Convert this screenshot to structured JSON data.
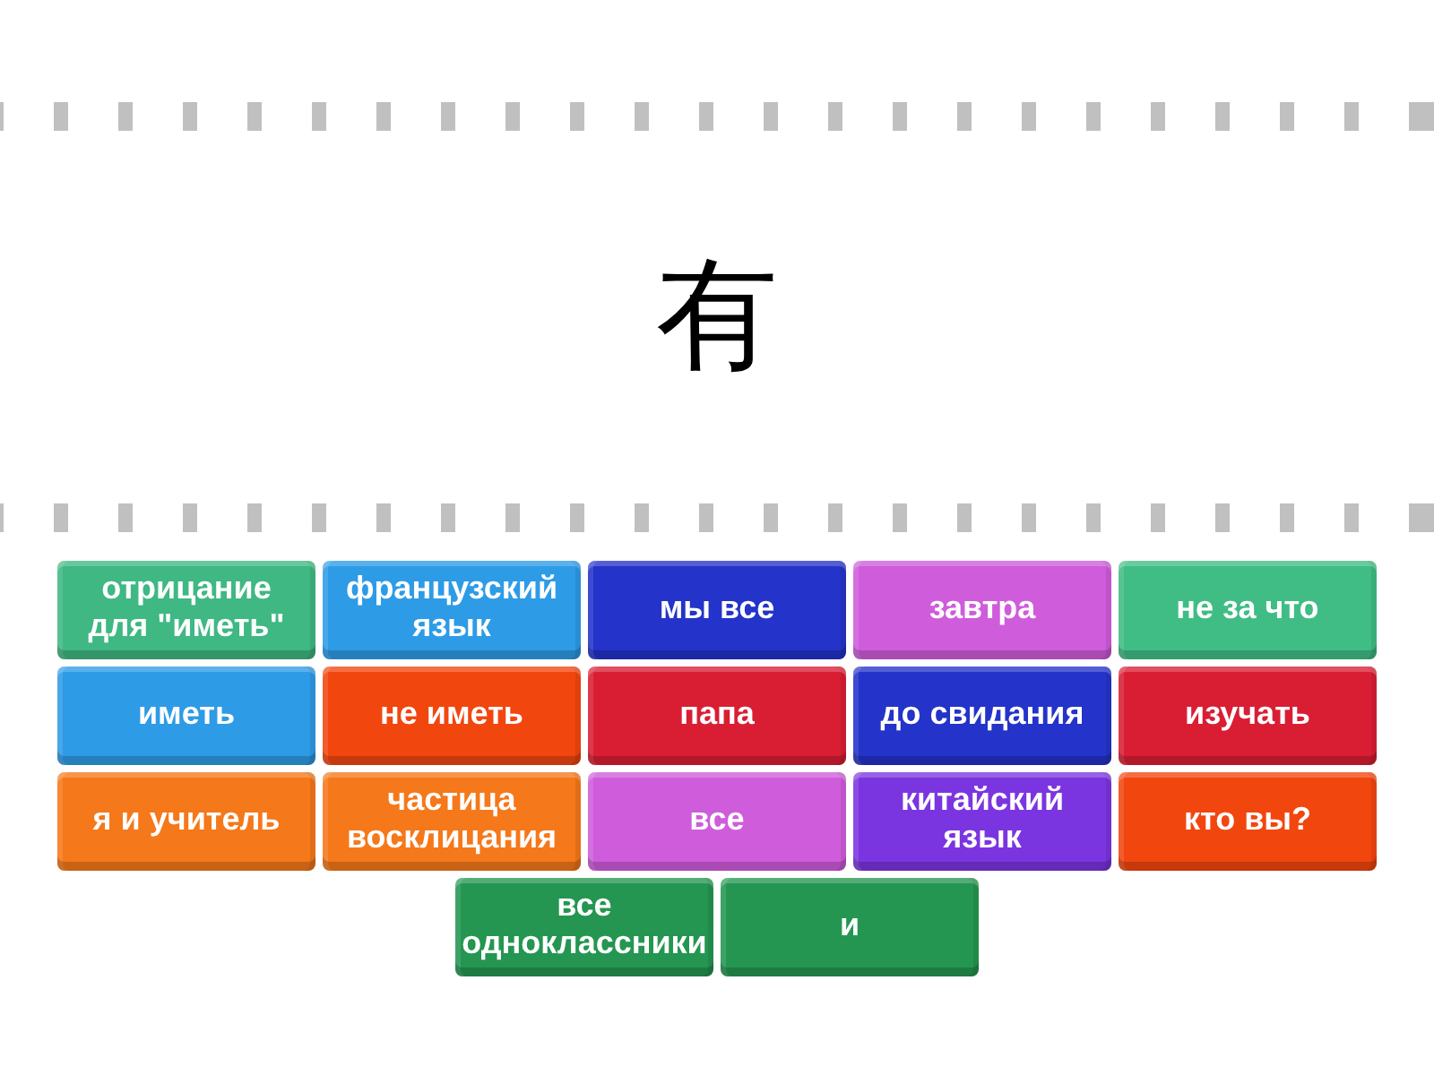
{
  "question": "有",
  "answers": [
    {
      "text": "отрицание\nдля \"иметь\"",
      "color": "#3fb883"
    },
    {
      "text": "французский\nязык",
      "color": "#2e9be6"
    },
    {
      "text": "мы все",
      "color": "#2433c9"
    },
    {
      "text": "завтра",
      "color": "#cf5cdb"
    },
    {
      "text": "не за что",
      "color": "#3fbd85"
    },
    {
      "text": "иметь",
      "color": "#2e9be6"
    },
    {
      "text": "не иметь",
      "color": "#f2460f"
    },
    {
      "text": "папа",
      "color": "#d91e34"
    },
    {
      "text": "до свидания",
      "color": "#2433c9"
    },
    {
      "text": "изучать",
      "color": "#d91e34"
    },
    {
      "text": "я и учитель",
      "color": "#f5781a"
    },
    {
      "text": "частица\nвосклицания",
      "color": "#f5781a"
    },
    {
      "text": "все",
      "color": "#cf5cdb"
    },
    {
      "text": "китайский\nязык",
      "color": "#7b35e0"
    },
    {
      "text": "кто вы?",
      "color": "#f2460f"
    },
    {
      "text": "все\nодноклассники",
      "color": "#249651"
    },
    {
      "text": "и",
      "color": "#249651"
    }
  ]
}
